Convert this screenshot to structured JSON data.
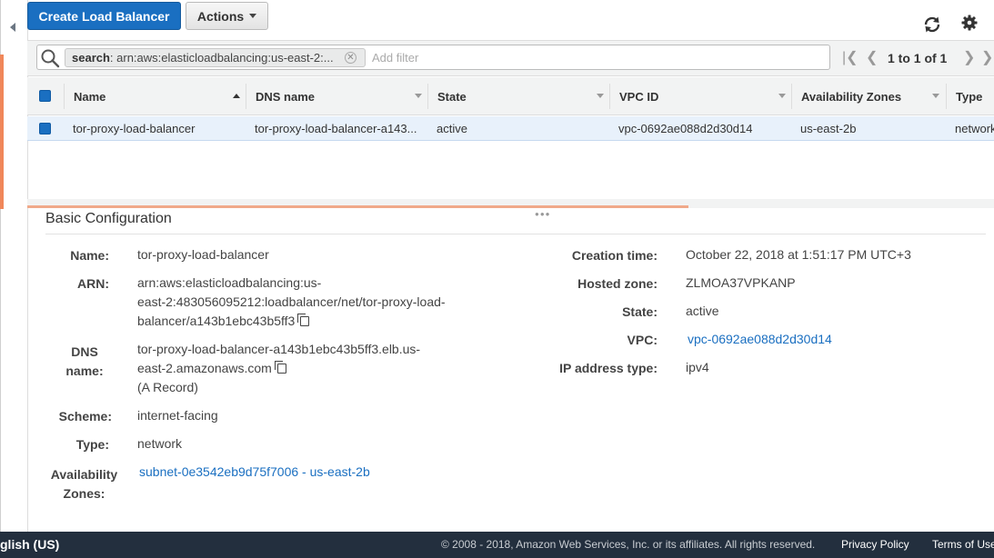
{
  "toolbar": {
    "create_label": "Create Load Balancer",
    "actions_label": "Actions",
    "refresh_icon": "refresh-icon",
    "settings_icon": "gear-icon"
  },
  "filter": {
    "token_key": "search",
    "token_value": ": arn:aws:elasticloadbalancing:us-east-2:...",
    "placeholder": "Add filter",
    "pager": "1 to 1 of 1"
  },
  "table": {
    "columns": [
      "Name",
      "DNS name",
      "State",
      "VPC ID",
      "Availability Zones",
      "Type"
    ],
    "rows": [
      {
        "name": "tor-proxy-load-balancer",
        "dns": "tor-proxy-load-balancer-a143...",
        "state": "active",
        "vpc": "vpc-0692ae088d2d30d14",
        "az": "us-east-2b",
        "type": "network"
      }
    ]
  },
  "details": {
    "section_title": "Basic Configuration",
    "name_label": "Name:",
    "name_value": "tor-proxy-load-balancer",
    "arn_label": "ARN:",
    "arn_line1": "arn:aws:elasticloadbalancing:us-",
    "arn_line2": "east-2:483056095212:loadbalancer/net/tor-proxy-load-",
    "arn_line3": "balancer/a143b1ebc43b5ff3",
    "dns_label_1": "DNS",
    "dns_label_2": "name:",
    "dns_line1": "tor-proxy-load-balancer-a143b1ebc43b5ff3.elb.us-",
    "dns_line2": "east-2.amazonaws.com",
    "dns_line3": "(A Record)",
    "scheme_label": "Scheme:",
    "scheme_value": "internet-facing",
    "type_label": "Type:",
    "type_value": "network",
    "az_label_1": "Availability",
    "az_label_2": "Zones:",
    "az_value": "subnet-0e3542eb9d75f7006 - us-east-2b",
    "created_label": "Creation time:",
    "created_value": "October 22, 2018 at 1:51:17 PM UTC+3",
    "hosted_label": "Hosted zone:",
    "hosted_value": "ZLMOA37VPKANP",
    "state_label": "State:",
    "state_value": "active",
    "vpc_label": "VPC:",
    "vpc_value": "vpc-0692ae088d2d30d14",
    "ip_label": "IP address type:",
    "ip_value": "ipv4"
  },
  "footer": {
    "language": "glish (US)",
    "copyright": "© 2008 - 2018, Amazon Web Services, Inc. or its affiliates. All rights reserved.",
    "privacy": "Privacy Policy",
    "terms": "Terms of Use"
  }
}
